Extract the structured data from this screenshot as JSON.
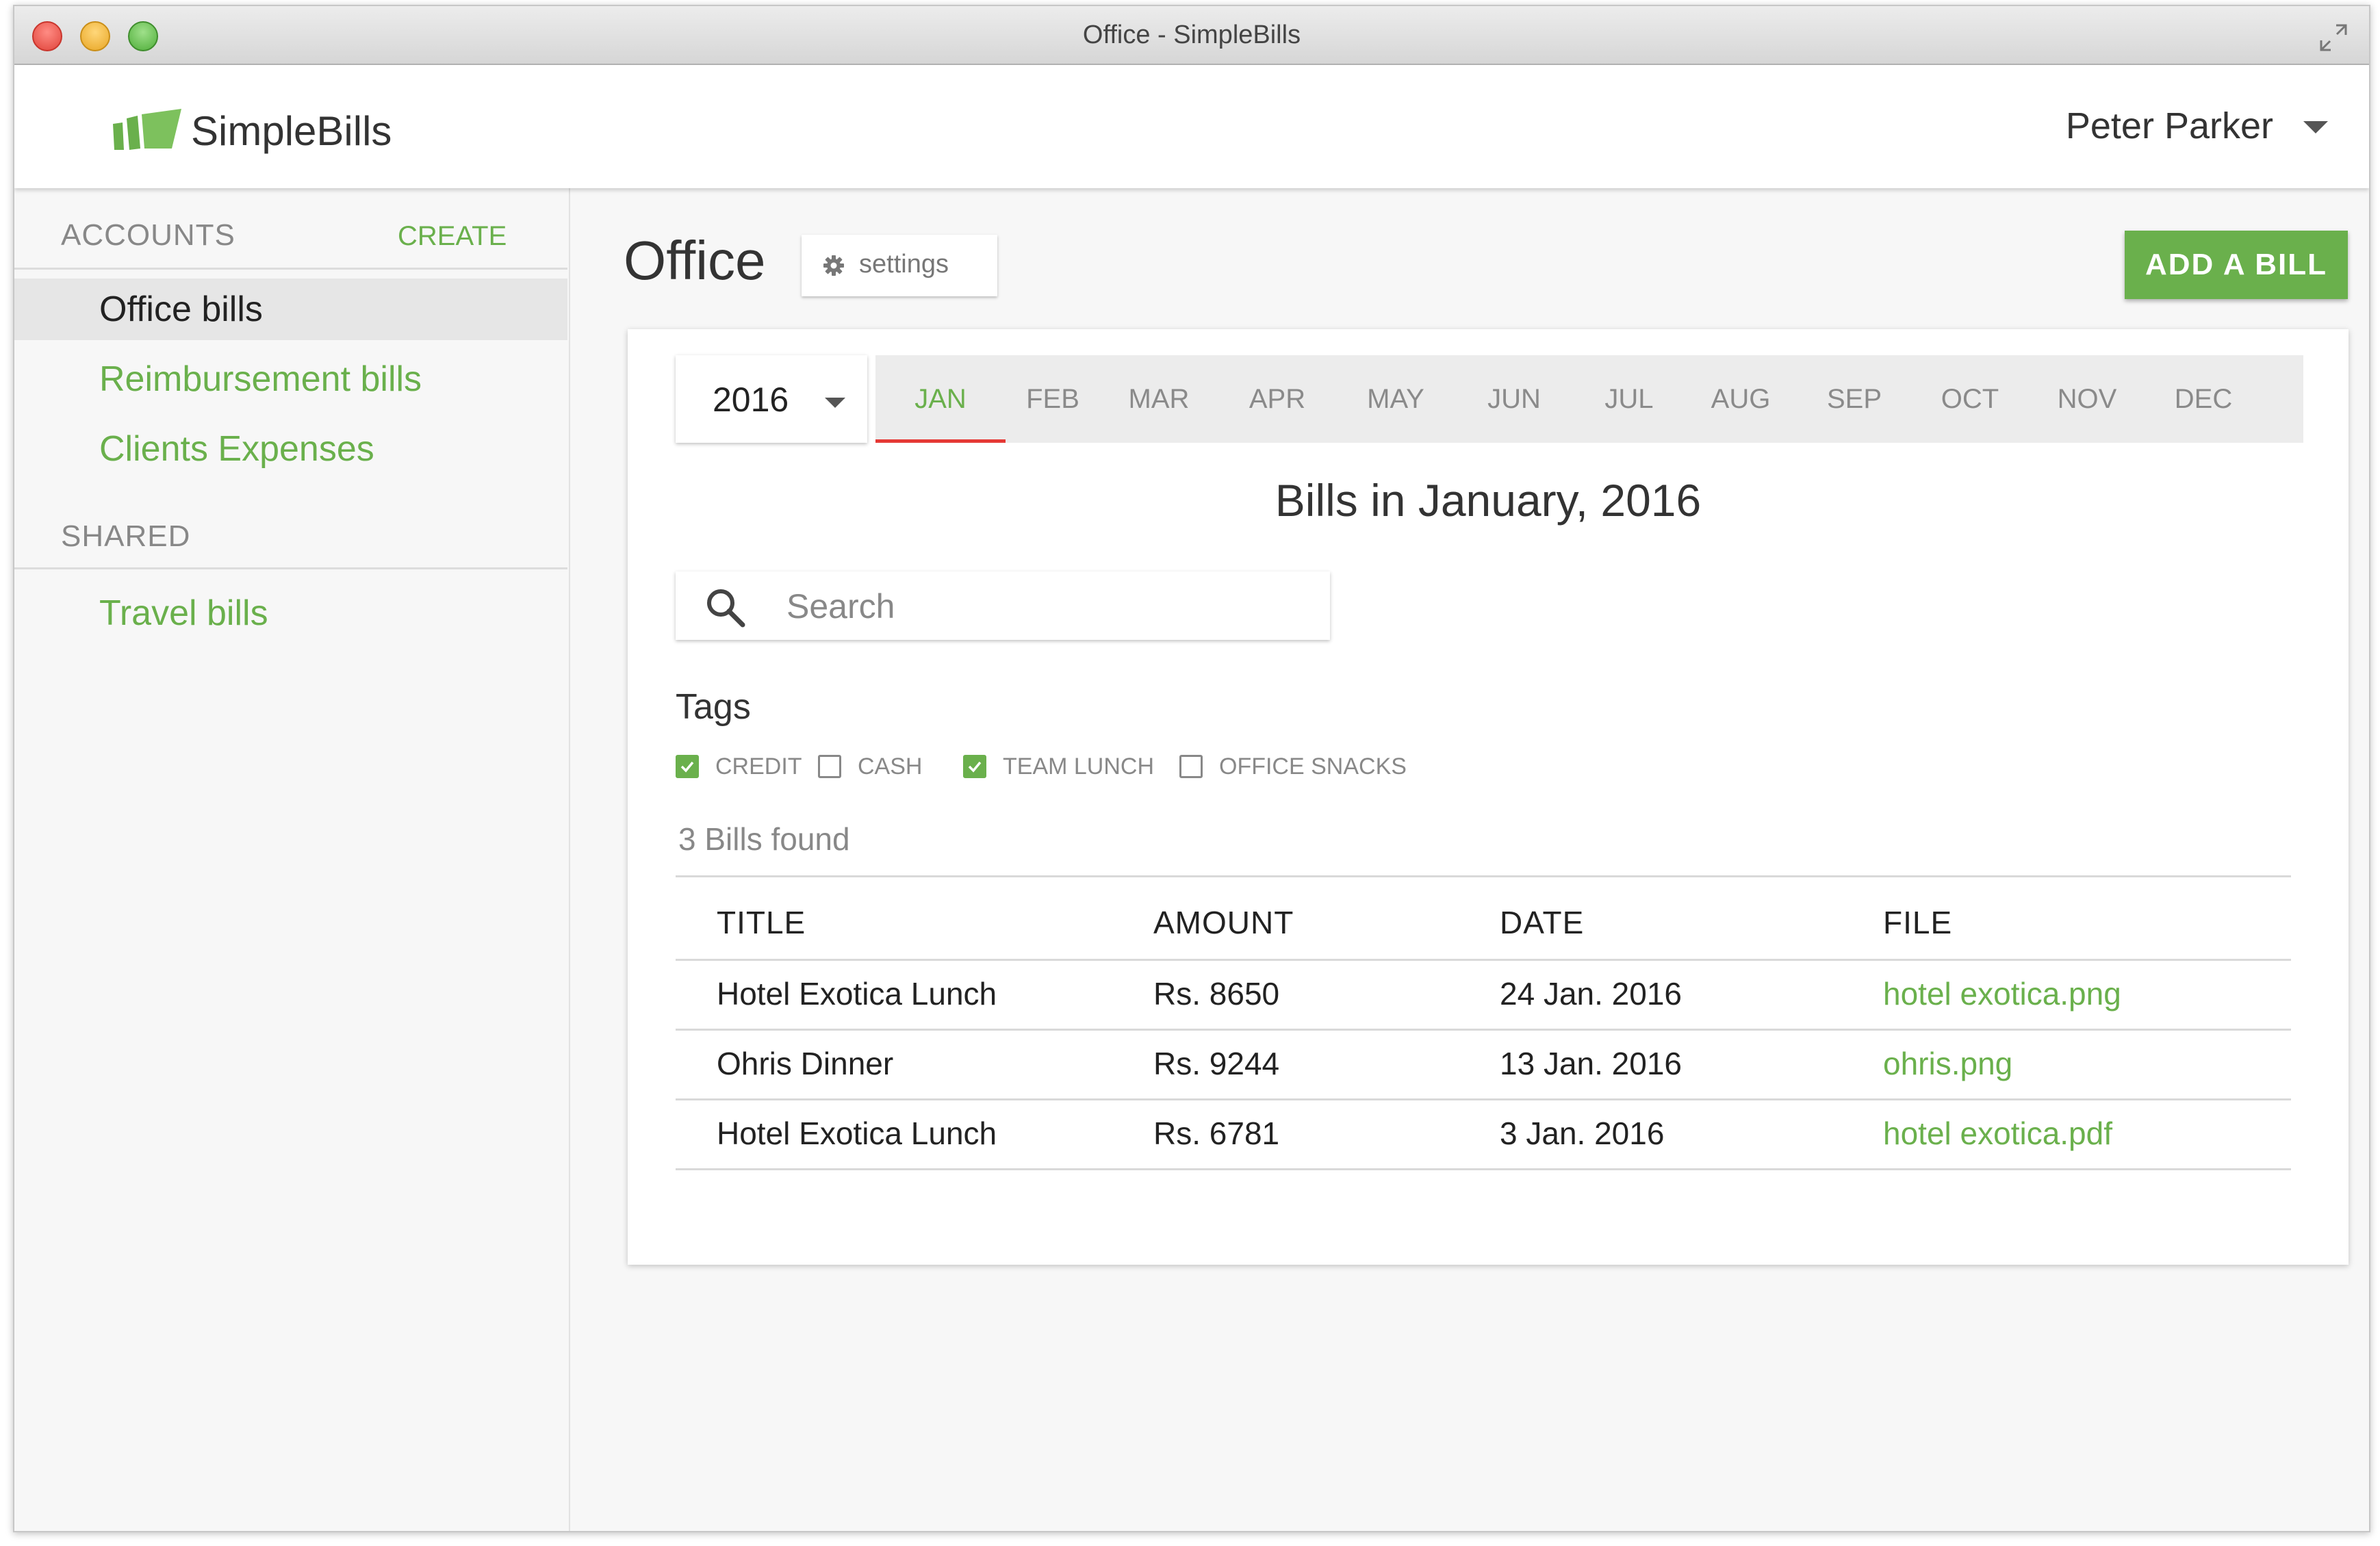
{
  "window": {
    "title": "Office - SimpleBills"
  },
  "app": {
    "brand": "SimpleBills",
    "user_name": "Peter Parker"
  },
  "sidebar": {
    "accounts_heading": "ACCOUNTS",
    "create_label": "CREATE",
    "accounts": [
      {
        "label": "Office bills",
        "active": true
      },
      {
        "label": "Reimbursement bills",
        "active": false
      },
      {
        "label": "Clients Expenses",
        "active": false
      }
    ],
    "shared_heading": "SHARED",
    "shared": [
      {
        "label": "Travel bills"
      }
    ]
  },
  "main": {
    "title": "Office",
    "settings_label": "settings",
    "add_bill_label": "ADD A BILL",
    "year": "2016",
    "months": [
      "JAN",
      "FEB",
      "MAR",
      "APR",
      "MAY",
      "JUN",
      "JUL",
      "AUG",
      "SEP",
      "OCT",
      "NOV",
      "DEC"
    ],
    "active_month": "JAN",
    "bills_heading": "Bills in January, 2016",
    "search_placeholder": "Search",
    "tags_title": "Tags",
    "tags": [
      {
        "label": "CREDIT",
        "checked": true
      },
      {
        "label": "CASH",
        "checked": false
      },
      {
        "label": "TEAM LUNCH",
        "checked": true
      },
      {
        "label": "OFFICE SNACKS",
        "checked": false
      }
    ],
    "found_text": "3 Bills found",
    "table": {
      "headers": [
        "TITLE",
        "AMOUNT",
        "DATE",
        "FILE"
      ],
      "rows": [
        {
          "title": "Hotel Exotica Lunch",
          "amount": "Rs. 8650",
          "date": "24 Jan. 2016",
          "file": "hotel exotica.png"
        },
        {
          "title": "Ohris Dinner",
          "amount": "Rs. 9244",
          "date": "13 Jan. 2016",
          "file": "ohris.png"
        },
        {
          "title": "Hotel Exotica Lunch",
          "amount": "Rs. 6781",
          "date": "3 Jan. 2016",
          "file": "hotel exotica.pdf"
        }
      ]
    }
  },
  "colors": {
    "accent": "#6ab04c",
    "tab_indicator": "#e53935"
  },
  "icons": [
    "simplebills-logo-icon",
    "caret-down-icon",
    "gear-icon",
    "search-icon",
    "checkbox-icon",
    "fullscreen-icon"
  ]
}
